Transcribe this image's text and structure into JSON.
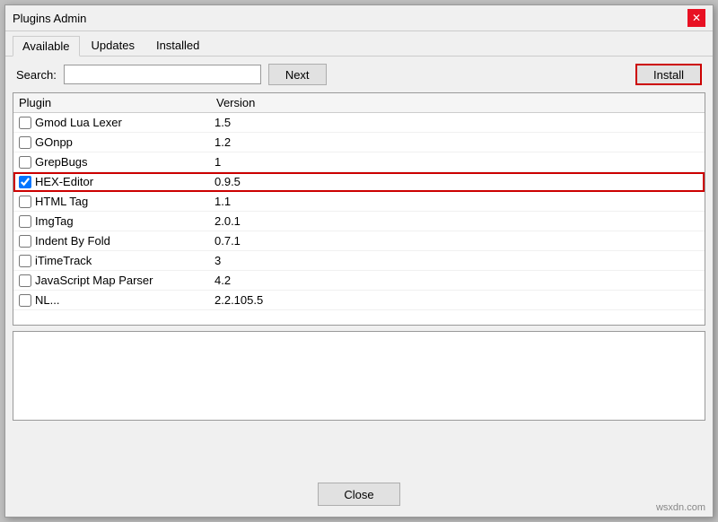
{
  "dialog": {
    "title": "Plugins Admin"
  },
  "tabs": [
    {
      "id": "available",
      "label": "Available",
      "active": true
    },
    {
      "id": "updates",
      "label": "Updates",
      "active": false
    },
    {
      "id": "installed",
      "label": "Installed",
      "active": false
    }
  ],
  "toolbar": {
    "search_label": "Search:",
    "search_value": "",
    "search_placeholder": "",
    "next_label": "Next",
    "install_label": "Install"
  },
  "table": {
    "col_plugin": "Plugin",
    "col_version": "Version",
    "rows": [
      {
        "name": "Gmod Lua Lexer",
        "version": "1.5",
        "checked": false,
        "highlighted": false
      },
      {
        "name": "GOnpp",
        "version": "1.2",
        "checked": false,
        "highlighted": false
      },
      {
        "name": "GrepBugs",
        "version": "1",
        "checked": false,
        "highlighted": false
      },
      {
        "name": "HEX-Editor",
        "version": "0.9.5",
        "checked": true,
        "highlighted": true
      },
      {
        "name": "HTML Tag",
        "version": "1.1",
        "checked": false,
        "highlighted": false
      },
      {
        "name": "ImgTag",
        "version": "2.0.1",
        "checked": false,
        "highlighted": false
      },
      {
        "name": "Indent By Fold",
        "version": "0.7.1",
        "checked": false,
        "highlighted": false
      },
      {
        "name": "iTimeTrack",
        "version": "3",
        "checked": false,
        "highlighted": false
      },
      {
        "name": "JavaScript Map Parser",
        "version": "4.2",
        "checked": false,
        "highlighted": false
      },
      {
        "name": "NL...",
        "version": "2.2.105.5",
        "checked": false,
        "highlighted": false
      }
    ]
  },
  "description": "",
  "footer": {
    "close_label": "Close"
  },
  "watermark": "wsxdn.com"
}
